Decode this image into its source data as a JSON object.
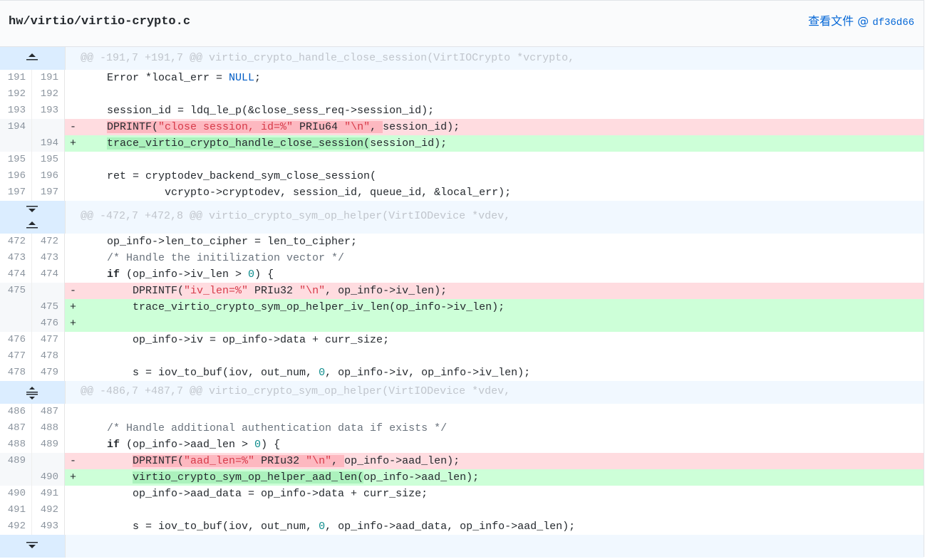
{
  "file": {
    "path": "hw/virtio/virtio-crypto.c",
    "view_label": "查看文件 @",
    "sha": "df36d66"
  },
  "hunks": [
    {
      "header": "@@ -191,7 +191,7 @@ virtio_crypto_handle_close_session(VirtIOCrypto *vcrypto,",
      "lines": [
        {
          "l": "191",
          "r": "191",
          "code": "    Error *local_err = NULL;"
        },
        {
          "l": "192",
          "r": "192",
          "code": ""
        },
        {
          "l": "193",
          "r": "193",
          "code": "    session_id = ldq_le_p(&close_sess_req->session_id);"
        },
        {
          "l": "194",
          "r": "",
          "sign": "-",
          "code": "    DPRINTF(\"close session, id=%\" PRIu64 \"\\n\", session_id);"
        },
        {
          "l": "",
          "r": "194",
          "sign": "+",
          "code": "    trace_virtio_crypto_handle_close_session(session_id);"
        },
        {
          "l": "195",
          "r": "195",
          "code": ""
        },
        {
          "l": "196",
          "r": "196",
          "code": "    ret = cryptodev_backend_sym_close_session("
        },
        {
          "l": "197",
          "r": "197",
          "code": "             vcrypto->cryptodev, session_id, queue_id, &local_err);"
        }
      ]
    },
    {
      "header": "@@ -472,7 +472,8 @@ virtio_crypto_sym_op_helper(VirtIODevice *vdev,",
      "lines": [
        {
          "l": "472",
          "r": "472",
          "code": "    op_info->len_to_cipher = len_to_cipher;"
        },
        {
          "l": "473",
          "r": "473",
          "code": "    /* Handle the initilization vector */"
        },
        {
          "l": "474",
          "r": "474",
          "code": "    if (op_info->iv_len > 0) {"
        },
        {
          "l": "475",
          "r": "",
          "sign": "-",
          "code": "        DPRINTF(\"iv_len=%\" PRIu32 \"\\n\", op_info->iv_len);"
        },
        {
          "l": "",
          "r": "475",
          "sign": "+",
          "code": "        trace_virtio_crypto_sym_op_helper_iv_len(op_info->iv_len);"
        },
        {
          "l": "",
          "r": "476",
          "sign": "+",
          "code": ""
        },
        {
          "l": "476",
          "r": "477",
          "code": "        op_info->iv = op_info->data + curr_size;"
        },
        {
          "l": "477",
          "r": "478",
          "code": ""
        },
        {
          "l": "478",
          "r": "479",
          "code": "        s = iov_to_buf(iov, out_num, 0, op_info->iv, op_info->iv_len);"
        }
      ]
    },
    {
      "header": "@@ -486,7 +487,7 @@ virtio_crypto_sym_op_helper(VirtIODevice *vdev,",
      "lines": [
        {
          "l": "486",
          "r": "487",
          "code": ""
        },
        {
          "l": "487",
          "r": "488",
          "code": "    /* Handle additional authentication data if exists */"
        },
        {
          "l": "488",
          "r": "489",
          "code": "    if (op_info->aad_len > 0) {"
        },
        {
          "l": "489",
          "r": "",
          "sign": "-",
          "code": "        DPRINTF(\"aad_len=%\" PRIu32 \"\\n\", op_info->aad_len);"
        },
        {
          "l": "",
          "r": "490",
          "sign": "+",
          "code": "        virtio_crypto_sym_op_helper_aad_len(op_info->aad_len);"
        },
        {
          "l": "490",
          "r": "491",
          "code": "        op_info->aad_data = op_info->data + curr_size;"
        },
        {
          "l": "491",
          "r": "492",
          "code": ""
        },
        {
          "l": "492",
          "r": "493",
          "code": "        s = iov_to_buf(iov, out_num, 0, op_info->aad_data, op_info->aad_len);"
        }
      ]
    }
  ],
  "icons": {
    "expand_up": "expand-up-icon",
    "expand_down": "expand-down-icon",
    "expand_both": "unfold-icon"
  },
  "colors": {
    "deletion_bg": "#ffdce0",
    "deletion_highlight": "#fdb8c0",
    "addition_bg": "#cdffd8",
    "addition_highlight": "#acf2bd",
    "hunk_bg": "#f1f8ff",
    "expander_bg": "#dbedff",
    "link": "#0366d6"
  }
}
